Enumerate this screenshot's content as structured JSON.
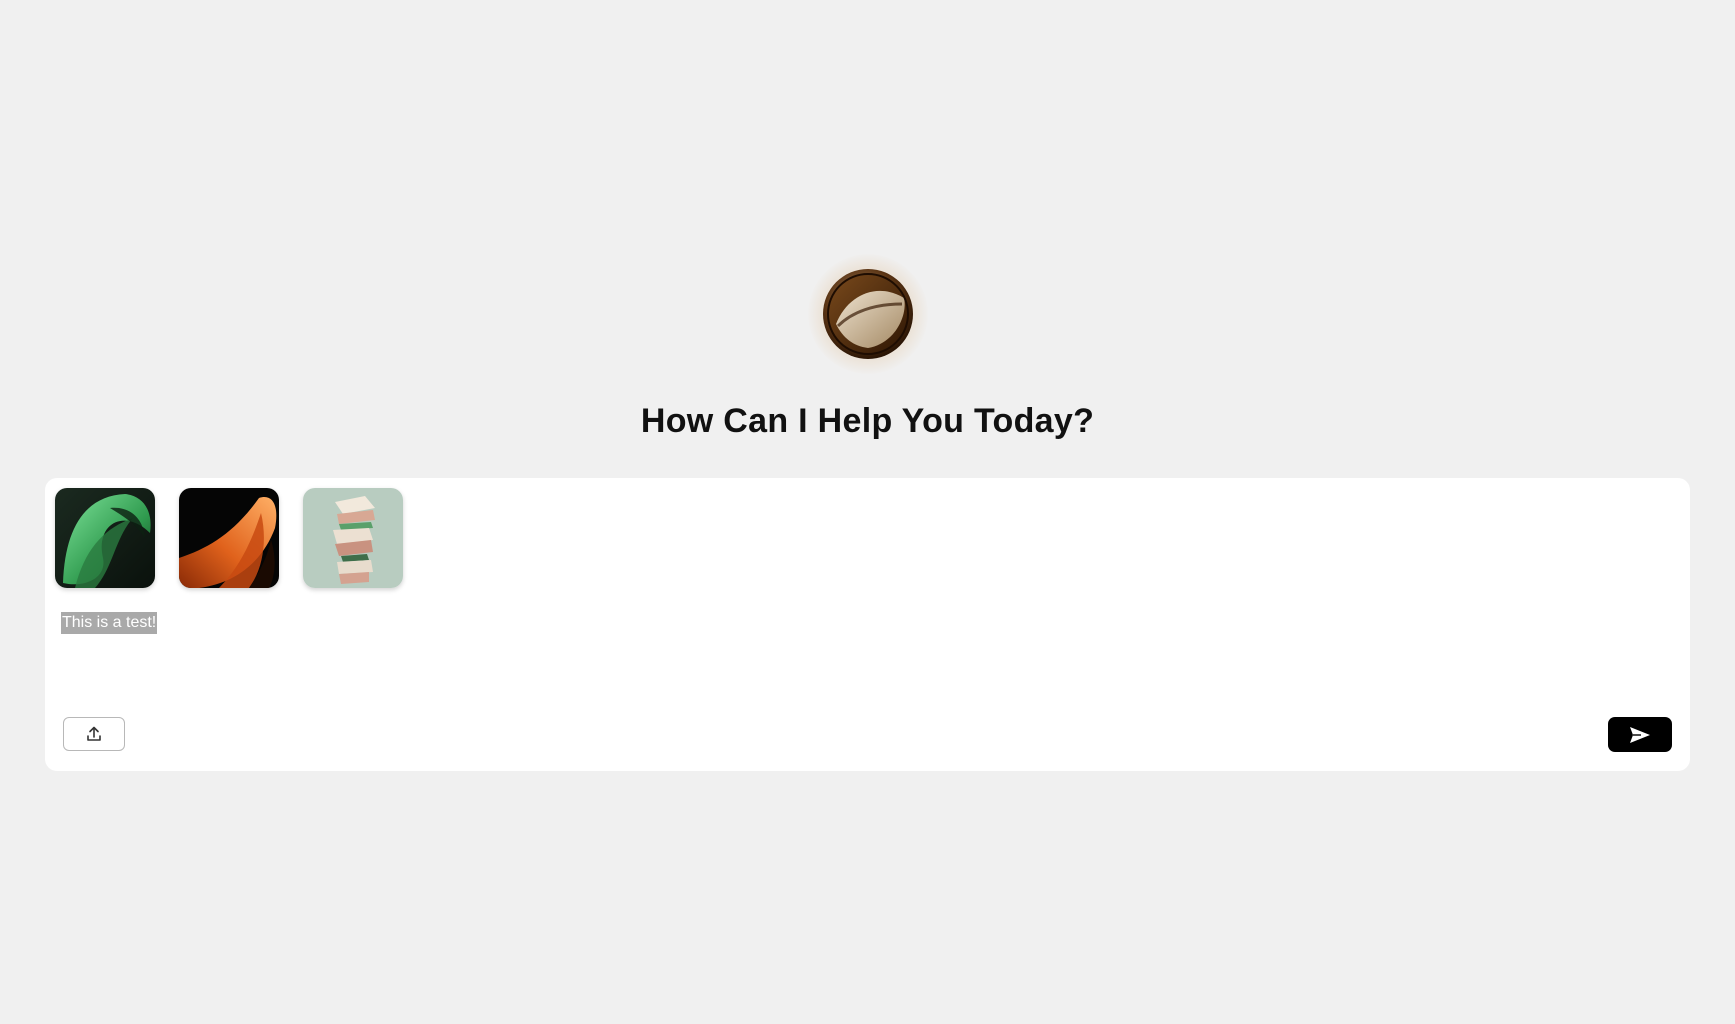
{
  "heading": "How Can I Help You Today?",
  "logo": {
    "icon": "orb-logo-icon"
  },
  "composer": {
    "attachments": [
      {
        "name": "green-ribbon-image",
        "colors": [
          "#0e1a12",
          "#2f9a4e",
          "#6fd58a"
        ]
      },
      {
        "name": "orange-ribbon-image",
        "colors": [
          "#000000",
          "#d45316",
          "#ffa04a"
        ]
      },
      {
        "name": "stacked-food-image",
        "colors": [
          "#b8ccc0",
          "#e8d8cc",
          "#c89a86"
        ]
      }
    ],
    "message": "This is a test!",
    "upload_icon": "upload-icon",
    "send_icon": "send-icon"
  },
  "colors": {
    "background": "#f0f0f0",
    "panel": "#ffffff",
    "send_button": "#000000",
    "selection": "#a9a9a9"
  }
}
